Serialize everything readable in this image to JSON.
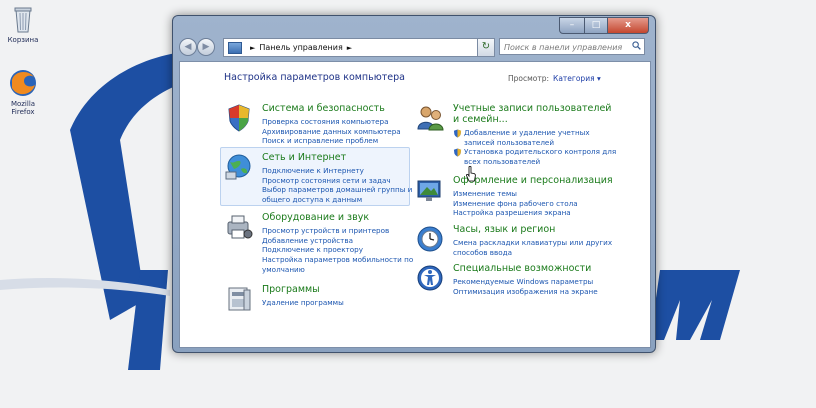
{
  "desktop": {
    "icons": [
      {
        "label": "Корзина",
        "icon": "recycle-bin-icon"
      },
      {
        "label": "Mozilla Firefox",
        "icon": "firefox-icon"
      }
    ]
  },
  "window": {
    "controls": {
      "minimize": "–",
      "maximize": "□",
      "close": "x"
    },
    "nav": {
      "back": "◀",
      "forward": "▶"
    },
    "address": {
      "path": "Панель управления",
      "separator": "►",
      "dropdown": "▾"
    },
    "refresh": "↻",
    "search": {
      "placeholder": "Поиск в панели управления"
    }
  },
  "content": {
    "heading": "Настройка параметров компьютера",
    "view_by_label": "Просмотр:",
    "view_by_value": "Категория ▾",
    "categories_left": [
      {
        "title": "Система и безопасность",
        "icon": "system-security-icon",
        "links": [
          "Проверка состояния компьютера",
          "Архивирование данных компьютера",
          "Поиск и исправление проблем"
        ]
      },
      {
        "title": "Сеть и Интернет",
        "icon": "network-internet-icon",
        "links": [
          "Подключение к Интернету",
          "Просмотр состояния сети и задач",
          "Выбор параметров домашней группы и",
          "общего доступа к данным"
        ]
      },
      {
        "title": "Оборудование и звук",
        "icon": "hardware-sound-icon",
        "links": [
          "Просмотр устройств и принтеров",
          "Добавление устройства",
          "Подключение к проектору",
          "Настройка параметров мобильности по",
          "умолчанию"
        ]
      },
      {
        "title": "Программы",
        "icon": "programs-icon",
        "links": [
          "Удаление программы"
        ]
      }
    ],
    "categories_right": [
      {
        "title_line1": "Учетные записи пользователей",
        "title_line2": "и семейн...",
        "icon": "user-accounts-icon",
        "links": [
          "Добавление и удаление учетных",
          "записей пользователей",
          "Установка родительского контроля для",
          "всех пользователей"
        ]
      },
      {
        "title": "Оформление и персонализация",
        "icon": "appearance-icon",
        "links": [
          "Изменение темы",
          "Изменение фона рабочего стола",
          "Настройка разрешения экрана"
        ]
      },
      {
        "title": "Часы, язык и регион",
        "icon": "clock-language-icon",
        "links": [
          "Смена раскладки клавиатуры или других",
          "способов ввода"
        ]
      },
      {
        "title": "Специальные возможности",
        "icon": "ease-of-access-icon",
        "links": [
          "Рекомендуемые Windows параметры",
          "Оптимизация изображения на экране"
        ]
      }
    ]
  },
  "colors": {
    "link": "#1c56b0",
    "category_title": "#1a7a1a",
    "heading": "#1e3287",
    "wallpaper_blue": "#1d4fa3"
  }
}
